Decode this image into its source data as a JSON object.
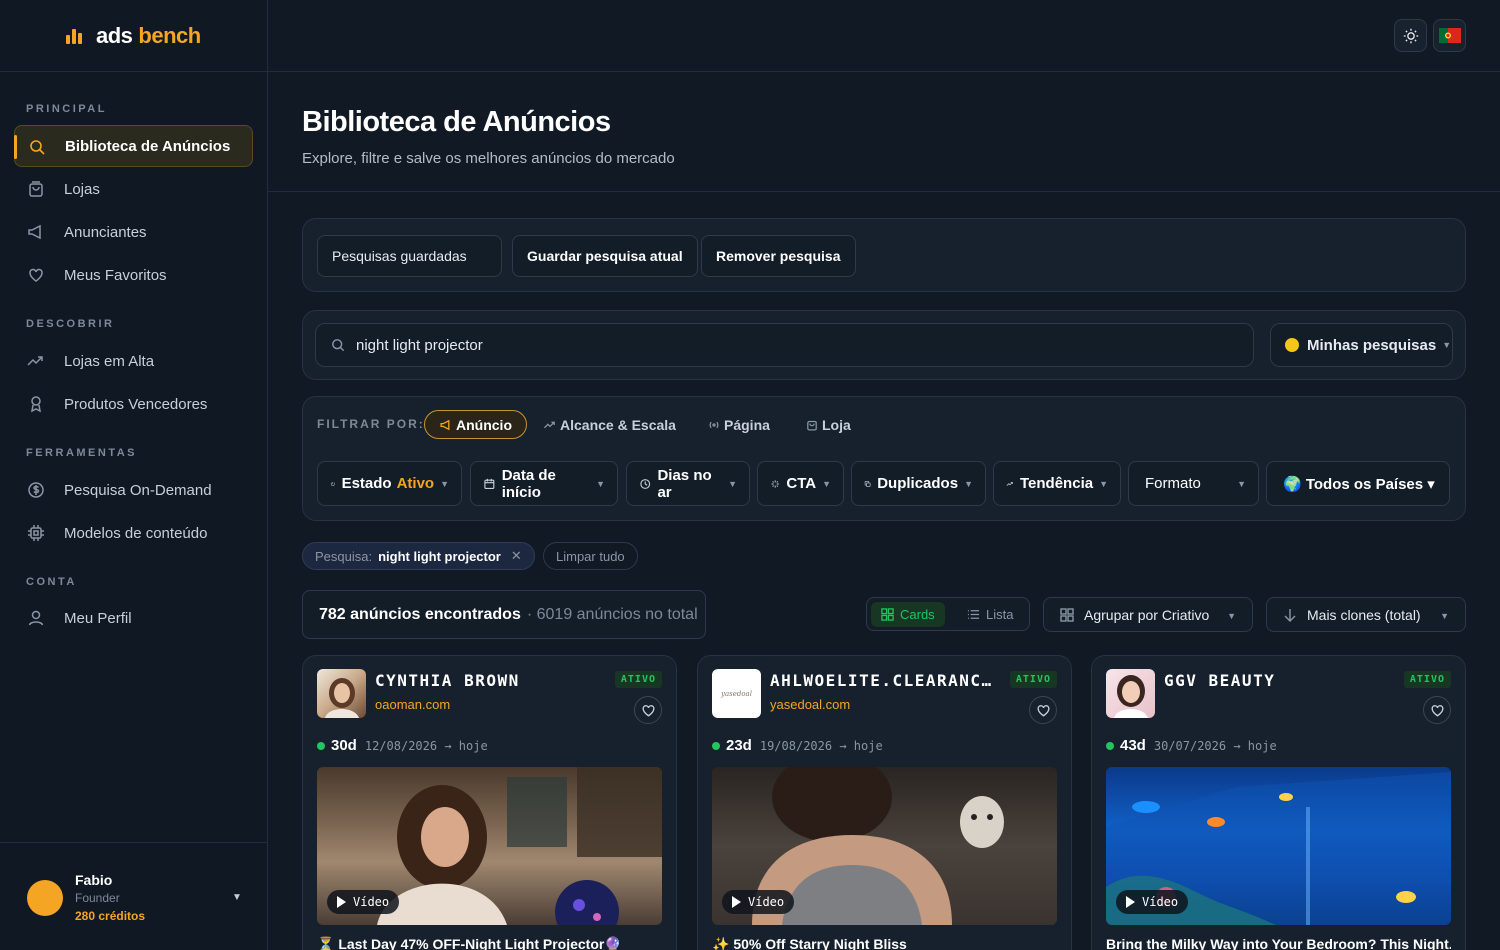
{
  "brand": {
    "word1": "ads",
    "word2": "bench"
  },
  "sidebar": {
    "sections": [
      "PRINCIPAL",
      "DESCOBRIR",
      "FERRAMENTAS",
      "CONTA"
    ],
    "items": [
      {
        "label": "Biblioteca de Anúncios",
        "icon": "search-icon"
      },
      {
        "label": "Lojas",
        "icon": "shopping-bag-icon"
      },
      {
        "label": "Anunciantes",
        "icon": "megaphone-icon"
      },
      {
        "label": "Meus Favoritos",
        "icon": "heart-icon"
      },
      {
        "label": "Lojas em Alta",
        "icon": "trending-up-icon"
      },
      {
        "label": "Produtos Vencedores",
        "icon": "award-icon"
      },
      {
        "label": "Pesquisa On-Demand",
        "icon": "dollar-circle-icon"
      },
      {
        "label": "Modelos de conteúdo",
        "icon": "chip-icon"
      },
      {
        "label": "Meu Perfil",
        "icon": "user-icon"
      }
    ],
    "user": {
      "name": "Fabio",
      "role": "Founder",
      "credits": "280 créditos"
    }
  },
  "header": {
    "title": "Biblioteca de Anúncios",
    "subtitle": "Explore, filtre e salve os melhores anúncios do mercado"
  },
  "saved_searches": {
    "saved_label": "Pesquisas guardadas",
    "save_label": "Guardar pesquisa atual",
    "remove_label": "Remover pesquisa"
  },
  "search": {
    "value": "night light projector",
    "my_searches": "Minhas pesquisas"
  },
  "filters": {
    "label": "FILTRAR POR:",
    "tabs": [
      "Anúncio",
      "Alcance & Escala",
      "Página",
      "Loja"
    ],
    "dropdowns": {
      "estado": "Estado",
      "estado_value": "Ativo",
      "data": "Data de início",
      "dias": "Dias no ar",
      "cta": "CTA",
      "duplicados": "Duplicados",
      "tendencia": "Tendência",
      "formato": "Formato",
      "paises": "🌍 Todos os Países ▾"
    }
  },
  "active_filters": {
    "prefix": "Pesquisa:",
    "value": "night light projector",
    "clear": "Limpar tudo"
  },
  "results": {
    "found": "782 anúncios encontrados",
    "total": "· 6019 anúncios no total",
    "view_cards": "Cards",
    "view_list": "Lista",
    "group_by": "Agrupar por Criativo",
    "sort_by": "Mais clones (total)"
  },
  "cards": [
    {
      "name": "CYNTHIA BROWN",
      "domain": "oaoman.com",
      "status": "ATIVO",
      "days": "30d",
      "range": "12/08/2026 → hoje",
      "media": "Vídeo",
      "title": "⏳ Last Day 47% OFF-Night Light Projector🔮"
    },
    {
      "name": "AHLWOELITE.CLEARANCE-SALE",
      "domain": "yasedoal.com",
      "status": "ATIVO",
      "days": "23d",
      "range": "19/08/2026 → hoje",
      "media": "Vídeo",
      "title": "✨ 50% Off Starry Night Bliss"
    },
    {
      "name": "GGV BEAUTY",
      "domain": "",
      "status": "ATIVO",
      "days": "43d",
      "range": "30/07/2026 → hoje",
      "media": "Vídeo",
      "title": "Bring the Milky Way into Your Bedroom? This Night..."
    }
  ]
}
